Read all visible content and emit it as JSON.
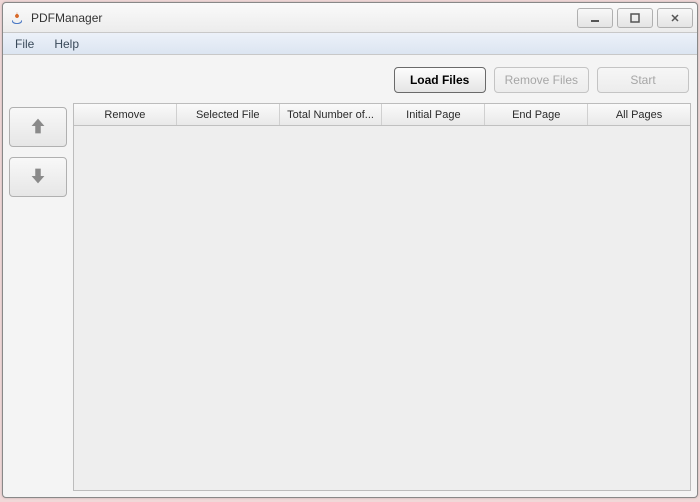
{
  "window": {
    "title": "PDFManager"
  },
  "menubar": {
    "file": "File",
    "help": "Help"
  },
  "toolbar": {
    "load_files": "Load Files",
    "remove_files": "Remove Files",
    "start": "Start"
  },
  "table": {
    "columns": {
      "remove": "Remove",
      "selected_file": "Selected File",
      "total_pages": "Total Number of...",
      "initial_page": "Initial Page",
      "end_page": "End Page",
      "all_pages": "All Pages"
    }
  }
}
